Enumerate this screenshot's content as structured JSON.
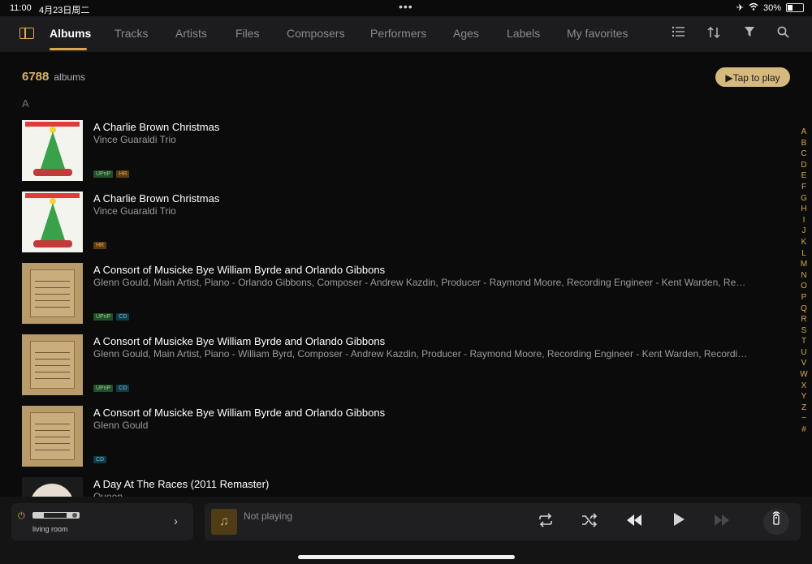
{
  "status_bar": {
    "time": "11:00",
    "date": "4月23日周二",
    "battery": "30%",
    "dots": "•••"
  },
  "nav": {
    "tabs": [
      "Albums",
      "Tracks",
      "Artists",
      "Files",
      "Composers",
      "Performers",
      "Ages",
      "Labels",
      "My favorites"
    ],
    "active_tab": "Albums",
    "icons": [
      "list-icon",
      "sort-icon",
      "filter-icon",
      "search-icon"
    ]
  },
  "summary": {
    "count": "6788",
    "count_label": "albums",
    "play_button": "Tap to play"
  },
  "section_letter": "A",
  "albums": [
    {
      "title": "A Charlie Brown Christmas",
      "artist": "Vince Guaraldi Trio",
      "badges": [
        "UPnP",
        "HR"
      ],
      "cover": "charlie-brown"
    },
    {
      "title": "A Charlie Brown Christmas",
      "artist": "Vince Guaraldi Trio",
      "badges": [
        "HR"
      ],
      "cover": "charlie-brown"
    },
    {
      "title": "A Consort of Musicke Bye William Byrde and Orlando Gibbons",
      "artist": "Glenn Gould, Main Artist, Piano - Orlando Gibbons, Composer - Andrew Kazdin, Producer - Raymond Moore, Recording Engineer - Kent Warden, Recordin…",
      "badges": [
        "UPnP",
        "CD"
      ],
      "cover": "gould"
    },
    {
      "title": "A Consort of Musicke Bye William Byrde and Orlando Gibbons",
      "artist": "Glenn Gould, Main Artist, Piano - William Byrd, Composer - Andrew Kazdin, Producer - Raymond Moore, Recording Engineer - Kent Warden, Recording En…",
      "badges": [
        "UPnP",
        "CD"
      ],
      "cover": "gould"
    },
    {
      "title": "A Consort of Musicke Bye William Byrde and Orlando Gibbons",
      "artist": "Glenn Gould",
      "badges": [
        "CD"
      ],
      "cover": "gould"
    },
    {
      "title": "A Day At The Races (2011 Remaster)",
      "artist": "Queen",
      "badges": [],
      "cover": "queen"
    }
  ],
  "alphabet": [
    "A",
    "B",
    "C",
    "D",
    "E",
    "F",
    "G",
    "H",
    "I",
    "J",
    "K",
    "L",
    "M",
    "N",
    "O",
    "P",
    "Q",
    "R",
    "S",
    "T",
    "U",
    "V",
    "W",
    "X",
    "Y",
    "Z",
    "~",
    "#"
  ],
  "zone": {
    "label": "living room"
  },
  "player": {
    "now_playing": "Not playing"
  },
  "colors": {
    "accent": "#d9a94f",
    "background": "#0b0b0c",
    "badge_upnp": "#244e2b",
    "badge_hr": "#5a3d0c",
    "badge_cd": "#113a49"
  }
}
